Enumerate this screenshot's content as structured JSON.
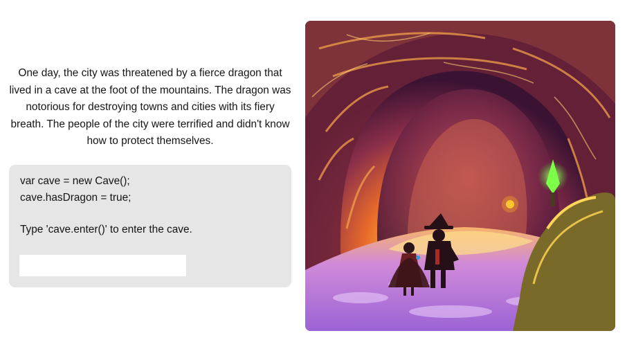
{
  "story": {
    "text": "One day, the city was threatened by a fierce dragon that lived in a cave at the foot of the mountains. The dragon was notorious for destroying towns and cities with its fiery breath. The people of the city were terrified and didn't know how to protect themselves."
  },
  "console": {
    "line1": "var cave = new Cave();",
    "line2": "cave.hasDragon = true;",
    "prompt": "Type 'cave.enter()' to enter the cave.",
    "input_value": "",
    "input_placeholder": ""
  },
  "scene": {
    "alt": "cave-entrance-illustration"
  }
}
